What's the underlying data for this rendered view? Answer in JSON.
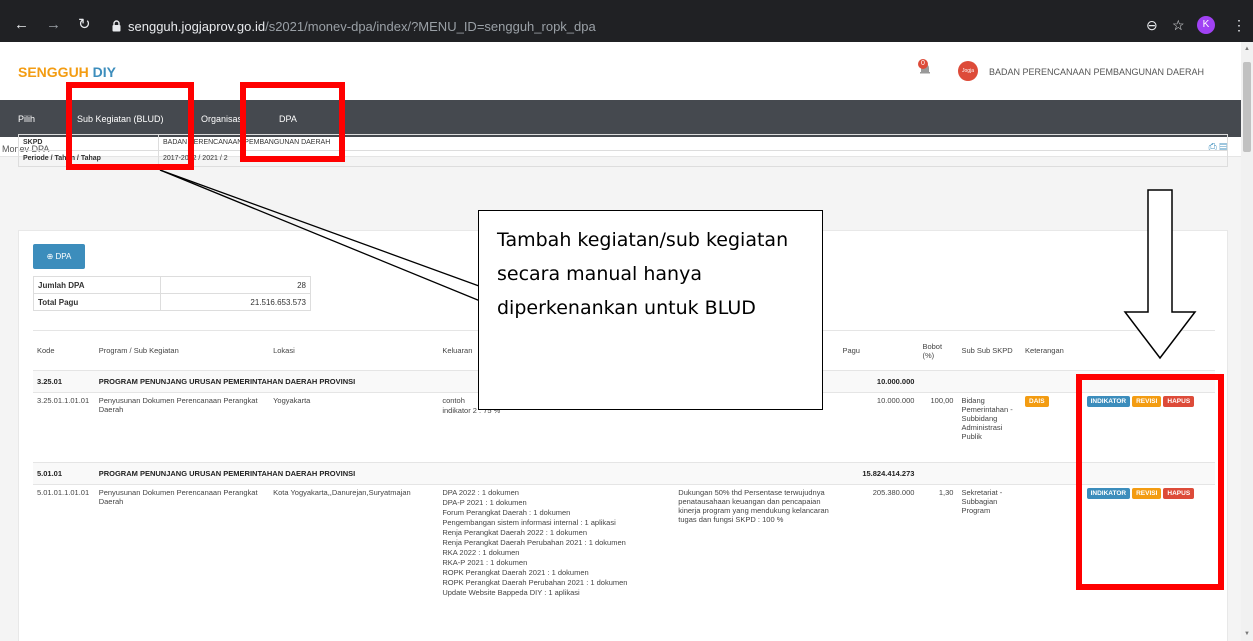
{
  "browser": {
    "url_host": "sengguh.jogjaprov.go.id",
    "url_path": "/s2021/monev-dpa/index/?MENU_ID=sengguh_ropk_dpa",
    "avatar_letter": "K"
  },
  "header": {
    "brand_a": "SENGGUH",
    "brand_b": " DIY",
    "notif_count": "0",
    "logo_text": "Jogja",
    "org_name": "BADAN PERENCANAAN PEMBANGUNAN DAERAH"
  },
  "nav": {
    "items": [
      "Pilih",
      "Sub Kegiatan (BLUD)",
      "Organisasi",
      "DPA"
    ]
  },
  "breadcrumb": "Monev DPA",
  "info": {
    "skpd_label": "SKPD",
    "skpd_value": "BADAN PERENCANAAN PEMBANGUNAN DAERAH",
    "periode_label": "Periode / Tahun / Tahap",
    "periode_value": "2017-2022 / 2021 / 2"
  },
  "dpa_button": "DPA",
  "summary": {
    "jumlah_label": "Jumlah DPA",
    "jumlah_value": "28",
    "pagu_label": "Total Pagu",
    "pagu_value": "21.516.653.573"
  },
  "table": {
    "headers": [
      "Kode",
      "Program / Sub Kegiatan",
      "Lokasi",
      "Keluaran",
      "",
      "Pagu",
      "Bobot (%)",
      "Sub Sub SKPD",
      "Keterangan",
      ""
    ],
    "prog1": {
      "kode": "3.25.01",
      "nama": "PROGRAM PENUNJANG URUSAN PEMERINTAHAN DAERAH PROVINSI",
      "pagu": "10.000.000"
    },
    "row1": {
      "kode": "3.25.01.1.01.01",
      "nama": "Penyusunan Dokumen Perencanaan Perangkat Daerah",
      "lokasi": "Yogyakarta",
      "keluaran": "contoh\nindikator 2 : 75 %",
      "hasil": "",
      "pagu": "10.000.000",
      "bobot": "100,00",
      "subsub": "Bidang Pemerintahan - Subbidang Administrasi Publik",
      "ket": "DAIS"
    },
    "prog2": {
      "kode": "5.01.01",
      "nama": "PROGRAM PENUNJANG URUSAN PEMERINTAHAN DAERAH PROVINSI",
      "pagu": "15.824.414.273"
    },
    "row2": {
      "kode": "5.01.01.1.01.01",
      "nama": "Penyusunan Dokumen Perencanaan Perangkat Daerah",
      "lokasi": "Kota Yogyakarta,,Danurejan,Suryatmajan",
      "keluaran": "DPA 2022 : 1 dokumen\nDPA-P 2021 : 1 dokumen\nForum Perangkat Daerah : 1 dokumen\nPengembangan sistem informasi internal : 1 aplikasi\nRenja Perangkat Daerah 2022 : 1 dokumen\nRenja Perangkat Daerah Perubahan 2021 : 1 dokumen\nRKA 2022 : 1 dokumen\nRKA-P 2021 : 1 dokumen\nROPK Perangkat Daerah 2021 : 1 dokumen\nROPK Perangkat Daerah Perubahan 2021 : 1 dokumen\nUpdate Website Bappeda DIY : 1 aplikasi",
      "hasil": "Dukungan 50% thd Persentase terwujudnya penatausahaan keuangan dan pencapaian kinerja program yang mendukung kelancaran tugas dan fungsi SKPD : 100 %",
      "pagu": "205.380.000",
      "bobot": "1,30",
      "subsub": "Sekretariat - Subbagian Program",
      "ket": ""
    },
    "actions": [
      "INDIKATOR",
      "REVISI",
      "HAPUS"
    ]
  },
  "callout": "Tambah kegiatan/sub kegiatan secara manual hanya diperkenankan untuk BLUD",
  "colors": {
    "navbar": "#45494f",
    "primary": "#3c8dbc",
    "warning": "#f39c12",
    "danger": "#dd4b39",
    "annotation": "#ff0000"
  }
}
